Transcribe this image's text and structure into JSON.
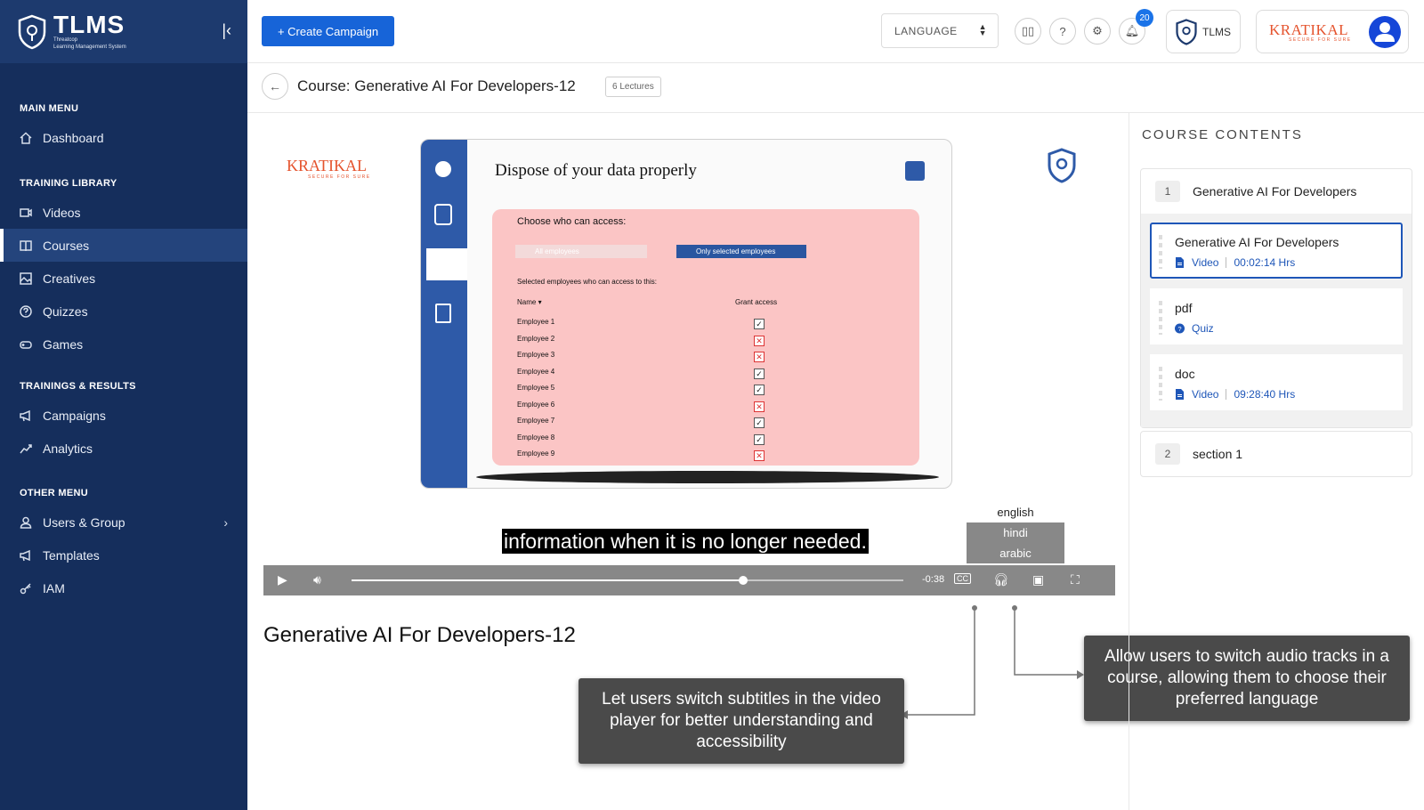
{
  "brand": {
    "name": "TLMS",
    "sub1": "Threatcop",
    "sub2": "Learning Management System"
  },
  "nav": {
    "sections": [
      {
        "title": "MAIN MENU",
        "items": [
          {
            "label": "Dashboard"
          }
        ]
      },
      {
        "title": "TRAINING LIBRARY",
        "items": [
          {
            "label": "Videos"
          },
          {
            "label": "Courses"
          },
          {
            "label": "Creatives"
          },
          {
            "label": "Quizzes"
          },
          {
            "label": "Games"
          }
        ]
      },
      {
        "title": "TRAININGS & RESULTS",
        "items": [
          {
            "label": "Campaigns"
          },
          {
            "label": "Analytics"
          }
        ]
      },
      {
        "title": "OTHER MENU",
        "items": [
          {
            "label": "Users & Group"
          },
          {
            "label": "Templates"
          },
          {
            "label": "IAM"
          }
        ]
      }
    ]
  },
  "topbar": {
    "create_label": "+ Create Campaign",
    "language_label": "LANGUAGE",
    "notif_count": "20",
    "tlms_label": "TLMS",
    "org_logo": "KRATIKAL",
    "org_tagline": "SECURE FOR SURE"
  },
  "course": {
    "title": "Course: Generative AI For Developers-12",
    "lectures": "6 Lectures"
  },
  "slide": {
    "heading": "Dispose of your data properly",
    "choose": "Choose who can access:",
    "option_all": "All employees",
    "option_selected": "Only selected employees",
    "selected_label": "Selected employees who can access to this:",
    "col_name": "Name ▾",
    "col_grant": "Grant access",
    "employees": [
      "Employee 1",
      "Employee 2",
      "Employee 3",
      "Employee 4",
      "Employee 5",
      "Employee 6",
      "Employee 7",
      "Employee 8",
      "Employee 9"
    ],
    "grants": [
      "yes",
      "no",
      "no",
      "yes",
      "yes",
      "no",
      "yes",
      "yes",
      "no"
    ],
    "left_logo": "KRATIKAL",
    "left_tagline": "SECURE FOR SURE"
  },
  "player": {
    "subtitle": "information when it is no longer needed.",
    "tracks": [
      "english",
      "hindi",
      "arabic"
    ],
    "time_remaining": "-0:38",
    "progress": 0.71,
    "video_title": "Generative AI For Developers-12"
  },
  "callouts": {
    "subtitles": "Let users switch subtitles in the video player for better understanding and accessibility",
    "audio": "Allow users to switch audio tracks in a course, allowing them to choose their preferred language"
  },
  "contents": {
    "header": "COURSE CONTENTS",
    "sections": [
      {
        "num": "1",
        "title": "Generative AI For Developers",
        "lessons": [
          {
            "name": "Generative AI For Developers",
            "type": "Video",
            "duration": "00:02:14 Hrs",
            "active": true
          },
          {
            "name": "pdf",
            "type": "Quiz",
            "duration": "",
            "active": false
          },
          {
            "name": "doc",
            "type": "Video",
            "duration": "09:28:40 Hrs",
            "active": false
          }
        ]
      },
      {
        "num": "2",
        "title": "section 1",
        "lessons": []
      }
    ]
  },
  "colors": {
    "sidebar": "#152e5c",
    "accent": "#1764d8",
    "brand_orange": "#e5532d"
  }
}
